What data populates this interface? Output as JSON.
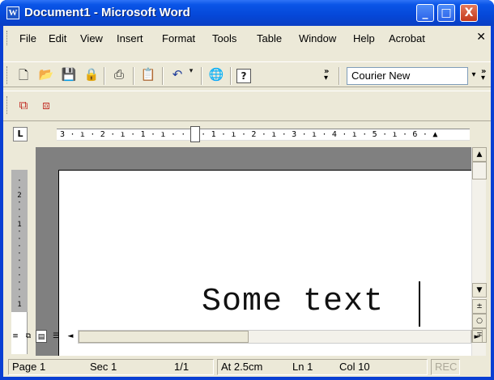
{
  "window": {
    "title": "Document1 - Microsoft Word"
  },
  "title_buttons": [
    "_",
    "□",
    "X"
  ],
  "menu": [
    "File",
    "Edit",
    "View",
    "Insert",
    "Format",
    "Tools",
    "Table",
    "Window",
    "Help",
    "Acrobat"
  ],
  "toolbar_standard": {
    "icons": [
      "new-document-icon",
      "open-folder-icon",
      "save-icon",
      "permission-icon",
      "print-icon",
      "paste-icon",
      "undo-icon",
      "web-icon",
      "help-icon"
    ],
    "overflow": "»",
    "font_name": "Courier New"
  },
  "toolbar_acrobat": {
    "icons": [
      "pdf-convert-icon",
      "pdf-email-icon"
    ]
  },
  "ruler": {
    "tab_selector": "L",
    "horizontal_text": "3 · ı · 2 · ı · 1 · ı ·   · ı · 1 · ı · 2 · ı · 3 · ı · 4 · ı · 5 · ı · 6 · ▲",
    "vertical_text": "·\n·\n2\n·\n·\n·\n1\n·\n·\n·\n·\n·\n·\n·\n·\n·\n·\n1"
  },
  "document": {
    "text": "Some text"
  },
  "scroll": {
    "up": "▲",
    "down": "▼",
    "prev": "±",
    "select": "○",
    "next": "∓",
    "left": "◄",
    "right": "►"
  },
  "status": {
    "page": "Page 1",
    "section": "Sec 1",
    "pages": "1/1",
    "at": "At 2.5cm",
    "line": "Ln 1",
    "col": "Col 10",
    "rec": "REC"
  }
}
